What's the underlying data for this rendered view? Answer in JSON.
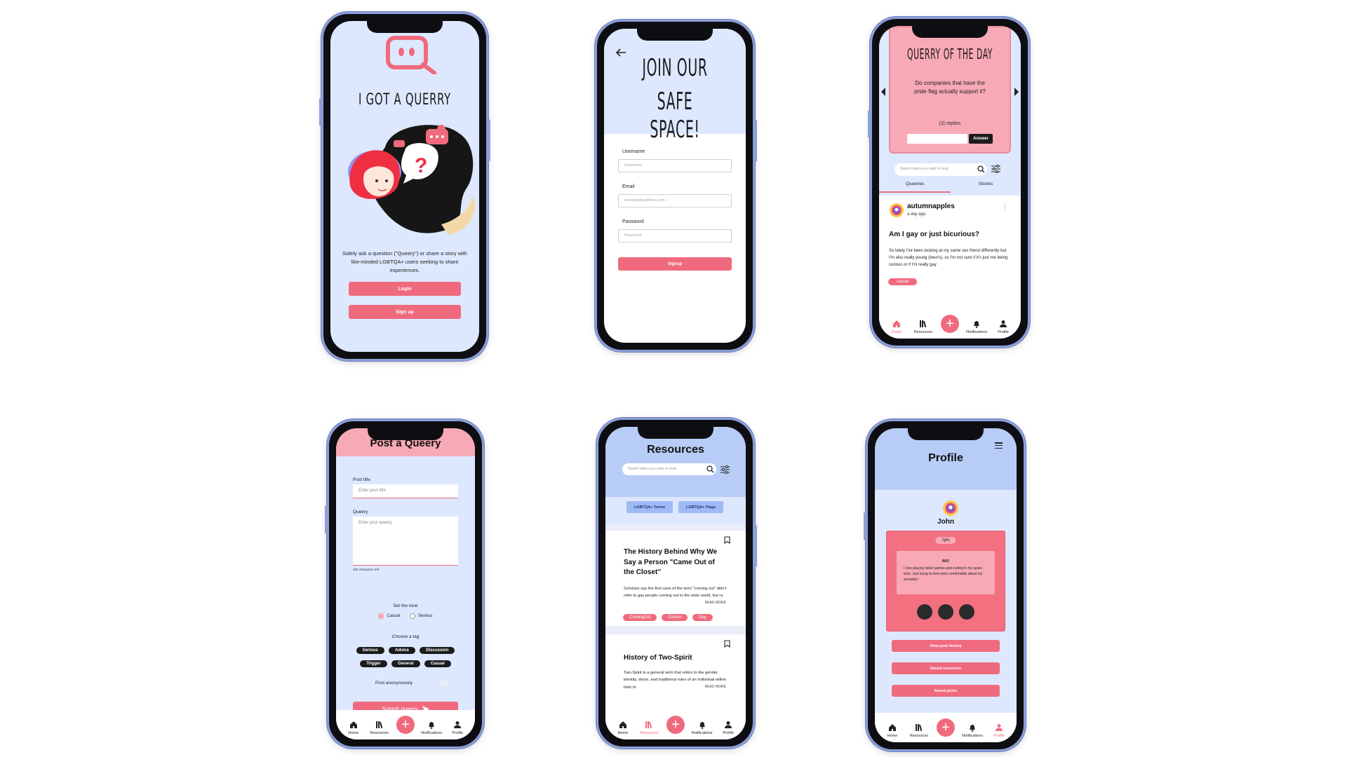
{
  "colors": {
    "accent": "#f06a7e",
    "background": "#dde8ff",
    "frame": "#8d9fd8"
  },
  "welcome": {
    "title": "I GOT A QUERRY",
    "description": "Safely ask a question (\"Queery\") or share a story with like-minded LGBTQA+ users seeking to share experiences.",
    "login_label": "Login",
    "signup_label": "Sign up",
    "bubble_mark": "?"
  },
  "signup": {
    "back_icon": "arrow-left-icon",
    "title_line1": "JOIN OUR",
    "title_line2": "SAFE SPACE!",
    "username_label": "Username",
    "username_placeholder": "Username",
    "email_label": "Email",
    "email_placeholder": "example@address.com",
    "password_label": "Password",
    "password_placeholder": "Password",
    "signup_label": "Signup"
  },
  "home": {
    "qotd_title": "QUERRY OF THE DAY",
    "qotd_question": "Do companies that have the pride flag actually support it?",
    "qotd_replies": "(3) replies",
    "answer_label": "Answer",
    "search_placeholder": "Search topics you want to read",
    "tabs": [
      "Queeries",
      "Stories"
    ],
    "post": {
      "username": "autumnapples",
      "time": "a day ago",
      "title": "Am I gay or just bicurious?",
      "body": "So lately I've been looking at my same sex friend differently but I'm also really young (teen's), so I'm not sure if it's just me being curious or if I'm really gay",
      "tag": "casual"
    }
  },
  "post_queery": {
    "title": "Post a Queery",
    "post_title_label": "Post title",
    "post_title_placeholder": "Enter your title",
    "queery_label": "Queery",
    "queery_placeholder": "Enter your queery",
    "chars_left": "250 characters left",
    "tone_label": "Set the tone",
    "tone_options": [
      "Casual",
      "Serious"
    ],
    "tone_selected": "Casual",
    "tag_label": "Choose a tag",
    "tags_row1": [
      "Serious",
      "Advice",
      "Discussion"
    ],
    "tags_row2": [
      "Trigger",
      "General",
      "Casual"
    ],
    "anon_label": "Post anonymously",
    "submit_label": "Submit queery"
  },
  "resources": {
    "title": "Resources",
    "search_placeholder": "Search topics you want to read",
    "filters": [
      "LGBTQA+ Terms",
      "LGBTQA+ Flags"
    ],
    "articles": [
      {
        "title": "The History Behind Why We Say a Person \"Came Out of the Closet\"",
        "body": "Scholars say the first uses of the term \"coming out\" didn't refer to gay people coming out to the wide world, but ra",
        "read_more": "READ MORE",
        "tags": [
          "ComingOut",
          "Culture",
          "Gay"
        ]
      },
      {
        "title": "History of Two-Spirit",
        "body": "Two-Spirit is a general term that refers to the gender identity, dress, and traditional roles of an individual within their tri",
        "read_more": "READ MORE",
        "tags": []
      }
    ]
  },
  "profile": {
    "title": "Profile",
    "name": "John",
    "points": "2pts",
    "bio_label": "BIO",
    "bio": "I love playing video games and coding in my spare time. Just trying to feel more comfortable about my sexuality!",
    "buttons": [
      "View post history",
      "Saved resources",
      "Saved posts"
    ]
  },
  "nav": {
    "home": "Home",
    "resources": "Resources",
    "notifications": "Notifications",
    "profile": "Profile",
    "add": "+"
  }
}
